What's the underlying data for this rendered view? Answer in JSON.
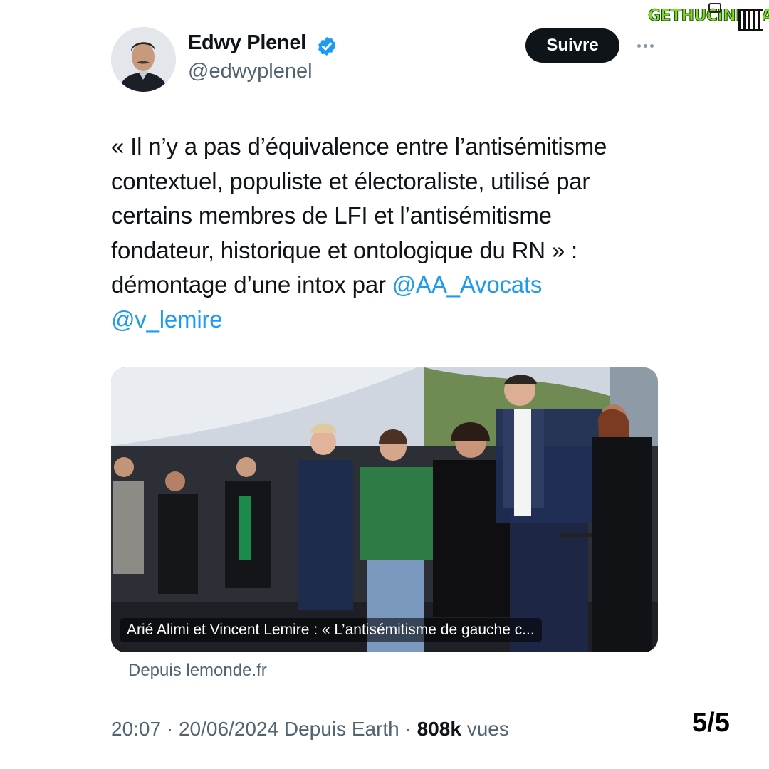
{
  "watermark": {
    "text": "GETHUCINEMA"
  },
  "author": {
    "name": "Edwy Plenel",
    "handle": "@edwyplenel",
    "verified": true,
    "avatar_icon": "user-avatar"
  },
  "actions": {
    "follow_label": "Suivre",
    "more_icon": "more-horizontal-icon"
  },
  "tweet": {
    "lines": [
      "« Il n’y a pas d’équivalence entre l’antisémitisme",
      "contextuel, populiste et électoraliste, utilisé par",
      "certains membres de LFI et l’antisémitisme",
      "fondateur, historique et ontologique du RN » :",
      "démontage d’une intox par "
    ],
    "mention_1": "@AA_Avocats",
    "mention_2": "@v_lemire"
  },
  "link_card": {
    "title": "Arié Alimi et Vincent Lemire : « L’antisémitisme de gauche c...",
    "source": "Depuis lemonde.fr"
  },
  "meta": {
    "time": "20:07",
    "date": "20/06/2024",
    "client": "Depuis Earth",
    "views_count": "808k",
    "views_label": "vues"
  },
  "page_indicator": "5/5",
  "colors": {
    "link": "#1d9bf0",
    "secondary_text": "#536471",
    "button_bg": "#0f1419",
    "verified_badge": "#1d9bf0"
  }
}
